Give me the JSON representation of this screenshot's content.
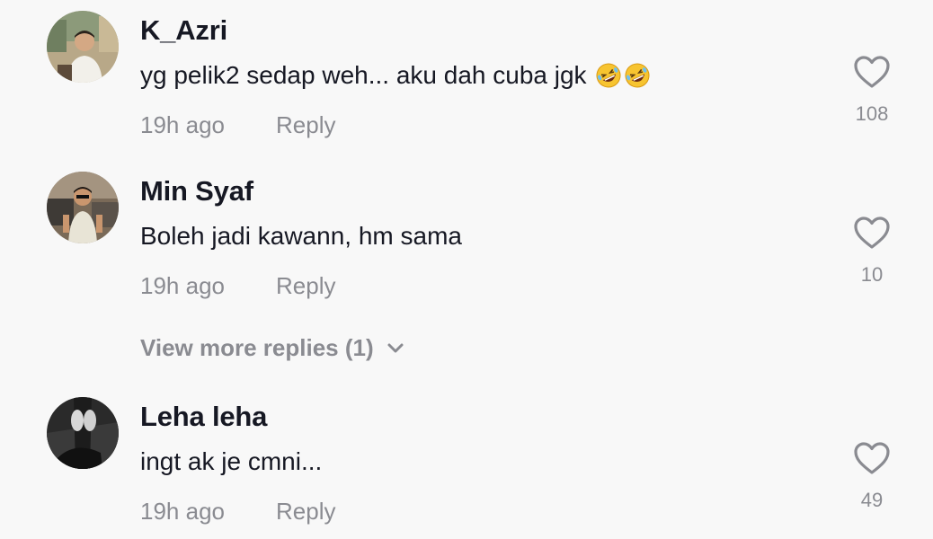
{
  "comments": [
    {
      "username": "K_Azri",
      "text": "yg pelik2 sedap weh... aku dah cuba jgk",
      "emojis": [
        "rolling-on-floor-laughing",
        "rolling-on-floor-laughing"
      ],
      "time": "19h ago",
      "reply_label": "Reply",
      "likes": "108"
    },
    {
      "username": "Min Syaf",
      "text": "Boleh jadi kawann, hm sama",
      "time": "19h ago",
      "reply_label": "Reply",
      "likes": "10"
    },
    {
      "username": "Leha leha",
      "text": "ingt ak je cmni...",
      "time": "19h ago",
      "reply_label": "Reply",
      "likes": "49"
    }
  ],
  "view_more": {
    "label": "View more replies (1)"
  },
  "colors": {
    "background": "#f8f8f8",
    "username": "#161823",
    "secondary": "#8a8b91"
  }
}
